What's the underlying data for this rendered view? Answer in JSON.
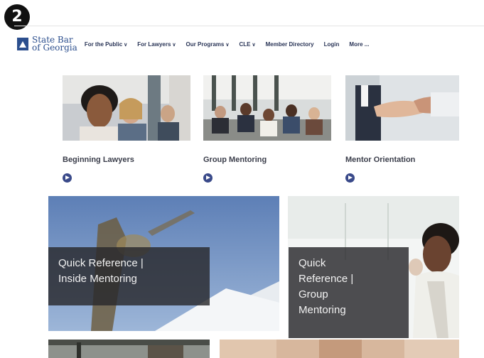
{
  "step": "2",
  "header": {
    "logo_line1": "State Bar",
    "logo_line2": "of Georgia",
    "nav": [
      {
        "label": "For the Public",
        "chevron": true
      },
      {
        "label": "For Lawyers",
        "chevron": true
      },
      {
        "label": "Our Programs",
        "chevron": true
      },
      {
        "label": "CLE",
        "chevron": true
      },
      {
        "label": "Member Directory",
        "chevron": false
      },
      {
        "label": "Login",
        "chevron": false
      },
      {
        "label": "More ...",
        "chevron": false
      }
    ]
  },
  "cards": [
    {
      "title": "Beginning Lawyers"
    },
    {
      "title": "Group Mentoring"
    },
    {
      "title": "Mentor Orientation"
    }
  ],
  "tiles": [
    {
      "line1": "Quick Reference |",
      "line2": "Inside Mentoring"
    },
    {
      "line1": "Quick",
      "line2": "Reference |",
      "line3": "Group",
      "line4": "Mentoring"
    }
  ],
  "colors": {
    "brand": "#2c4f8e",
    "nav_text": "#2a3557",
    "arrow": "#3a4a8a"
  }
}
